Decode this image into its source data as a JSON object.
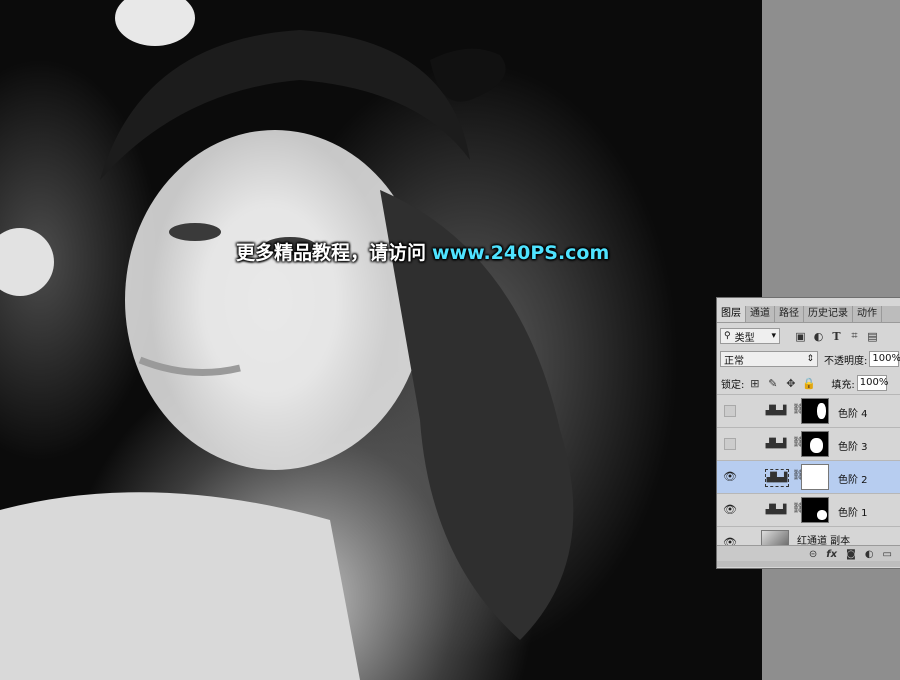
{
  "watermark": {
    "cn": "更多精品教程，请访问",
    "url": "www.240PS.com"
  },
  "layers_panel": {
    "tabs": [
      "图层",
      "通道",
      "路径",
      "历史记录",
      "动作"
    ],
    "filter_kind": "类型",
    "filter_icons": [
      "image-filter-icon",
      "adjustment-filter-icon",
      "type-filter-icon",
      "shape-filter-icon",
      "smart-object-filter-icon"
    ],
    "blend_mode": "正常",
    "opacity_label": "不透明度:",
    "opacity_value": "100%",
    "lock_label": "锁定:",
    "fill_label": "填充:",
    "fill_value": "100%",
    "layers": [
      {
        "name": "色阶 4",
        "visible": false,
        "selected": false
      },
      {
        "name": "色阶 3",
        "visible": false,
        "selected": false
      },
      {
        "name": "色阶 2",
        "visible": true,
        "selected": true
      },
      {
        "name": "色阶 1",
        "visible": true,
        "selected": false
      },
      {
        "name": "红通道 副本",
        "visible": true,
        "selected": false
      }
    ],
    "footer_icons": [
      "link-icon",
      "fx-icon",
      "add-mask-icon",
      "adjustment-layer-icon",
      "folder-icon"
    ]
  }
}
